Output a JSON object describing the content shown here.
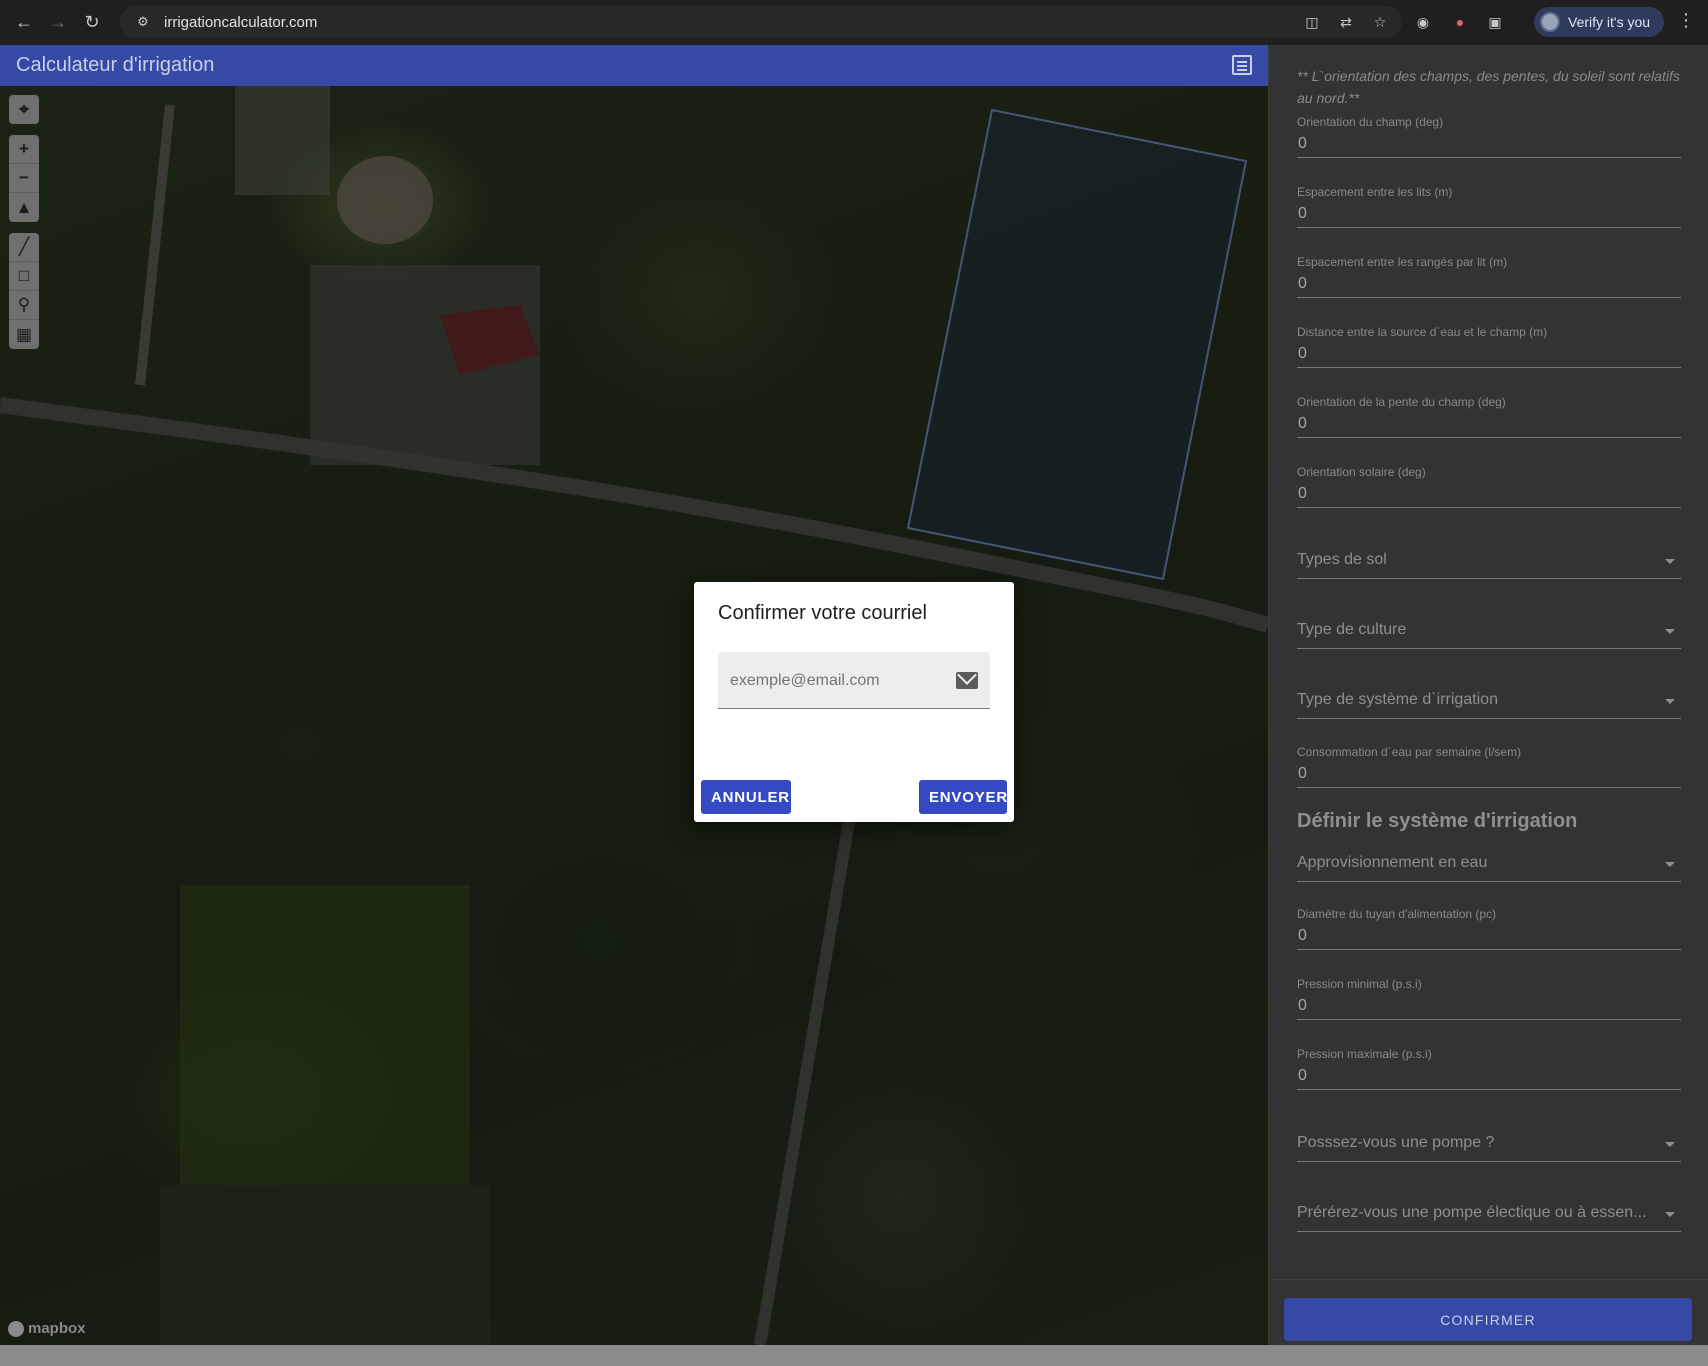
{
  "browser": {
    "url": "irrigationcalculator.com",
    "verify_label": "Verify it's you"
  },
  "app": {
    "title": "Calculateur d'irrigation",
    "map_attribution": "mapbox"
  },
  "map_controls": {
    "group1": [
      "geolocate-icon"
    ],
    "group2": [
      "zoom-in-icon",
      "zoom-out-icon",
      "compass-icon"
    ],
    "group3": [
      "draw-line-icon",
      "draw-polygon-icon",
      "draw-point-icon",
      "trash-icon"
    ]
  },
  "dialog": {
    "title": "Confirmer votre courriel",
    "email_placeholder": "exemple@email.com",
    "cancel_label": "ANNULER",
    "send_label": "ENVOYER"
  },
  "sidebar": {
    "note": "** L`orientation des champs, des pentes, du soleil sont relatifs au nord.**",
    "fields": [
      {
        "label": "Orientation du champ (deg)",
        "value": "0"
      },
      {
        "label": "Espacement entre les lits (m)",
        "value": "0"
      },
      {
        "label": "Espacement entre les rangés par lit (m)",
        "value": "0"
      },
      {
        "label": "Distance entre la source d`eau et le champ (m)",
        "value": "0"
      },
      {
        "label": "Orientation de la pente du champ (deg)",
        "value": "0"
      },
      {
        "label": "Orientation solaire (deg)",
        "value": "0"
      }
    ],
    "selects1": [
      {
        "label": "Types de sol"
      },
      {
        "label": "Type de culture"
      },
      {
        "label": "Type de système d`irrigation"
      }
    ],
    "water_consumption": {
      "label": "Consommation d`eau par semaine (l/sem)",
      "value": "0"
    },
    "section_title": "Définir le système d'irrigation",
    "water_supply_select": "Approvisionnement en eau",
    "fields2": [
      {
        "label": "Diamètre du tuyan d'alimentation (pc)",
        "value": "0"
      },
      {
        "label": "Pression minimal (p.s.i)",
        "value": "0"
      },
      {
        "label": "Pression maximale (p.s.i)",
        "value": "0"
      }
    ],
    "pump_select": "Posssez-vous une pompe ?",
    "pump_type_select": "Prérérez-vous une pompe électique ou à essen...",
    "confirm_label": "CONFIRMER"
  },
  "colors": {
    "primary": "#3549a5",
    "dialog_button": "#3549c4",
    "sidebar_bg": "#333333"
  }
}
